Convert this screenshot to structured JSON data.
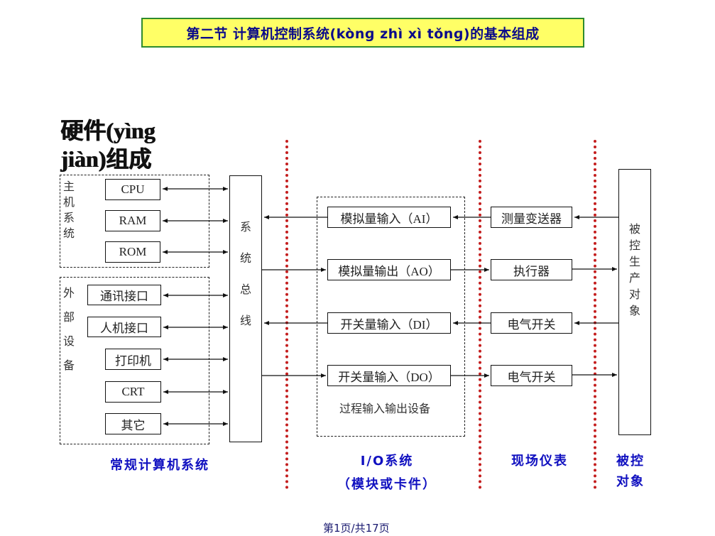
{
  "title": "第二节  计算机控制系统(kònɡ zhì xì tǒnɡ)的基本组成",
  "hardware_heading": {
    "line1": "硬件(yìng",
    "line2": "jiàn)组成"
  },
  "host_system": {
    "label": "主机系统",
    "items": [
      "CPU",
      "RAM",
      "ROM"
    ]
  },
  "peripherals": {
    "label": "外部设备",
    "items": [
      "通讯接口",
      "人机接口",
      "打印机",
      "CRT",
      "其它"
    ]
  },
  "system_bus": {
    "label": "系统总线"
  },
  "io_devices": {
    "items": [
      "模拟量输入（AI）",
      "模拟量输出（AO）",
      "开关量输入（DI）",
      "开关量输入（DO）"
    ],
    "caption": "过程输入输出设备"
  },
  "field_instruments": {
    "items": [
      "测量变送器",
      "执行器",
      "电气开关",
      "电气开关"
    ]
  },
  "controlled_object": {
    "label": "被控生产对象"
  },
  "section_labels": {
    "computer": "常规计算机系统",
    "io_line1": "I/O系统",
    "io_line2": "（模块或卡件）",
    "field": "现场仪表",
    "object_line1": "被控",
    "object_line2": "对象"
  },
  "colors": {
    "title_bg": "#ffff66",
    "title_border": "#2e8b2e",
    "title_text": "#0a0a8a",
    "divider": "#c41e1e",
    "section_label": "#1010c0"
  },
  "footer": {
    "page_text": "第1页/共17页"
  }
}
